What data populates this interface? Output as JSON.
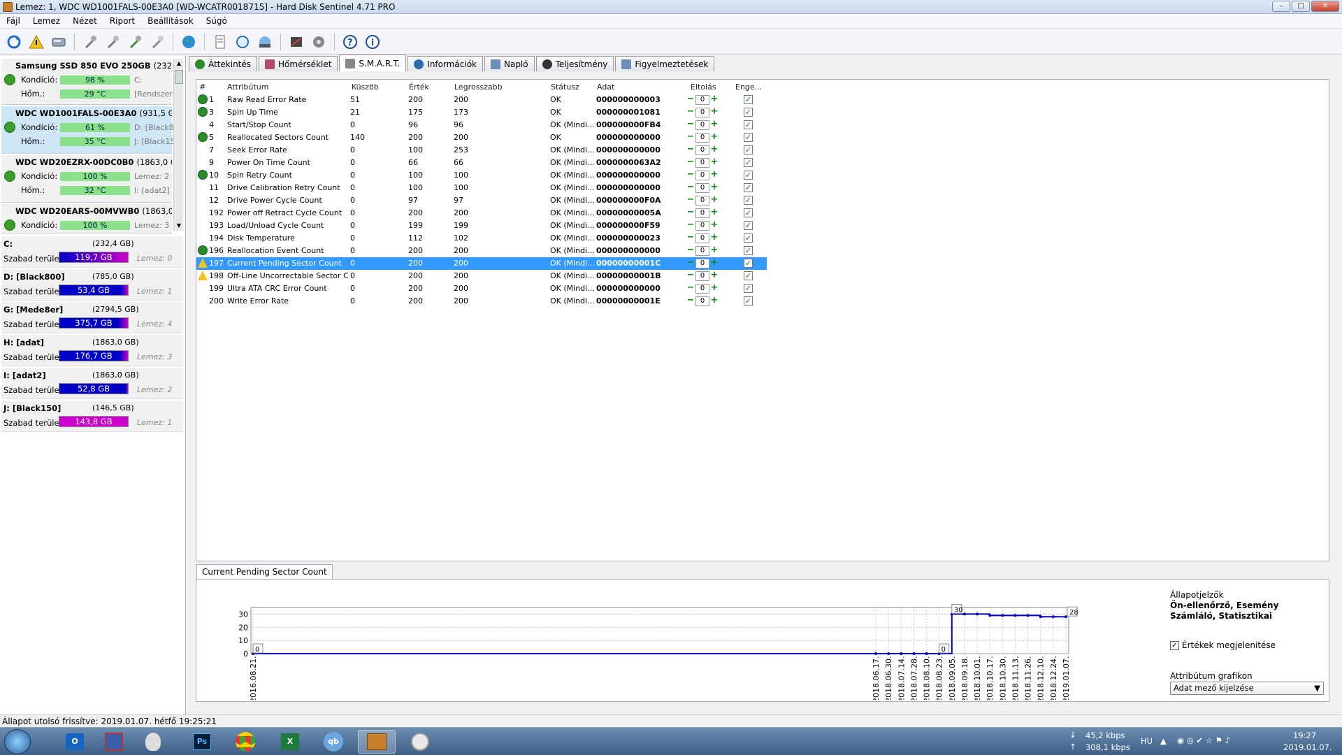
{
  "window": {
    "title": "Lemez: 1, WDC WD1001FALS-00E3A0 [WD-WCATR0018715] - Hard Disk Sentinel 4.71 PRO",
    "minimize": "–",
    "maximize": "□",
    "close": "✕"
  },
  "menu": [
    "Fájl",
    "Lemez",
    "Nézet",
    "Riport",
    "Beállítások",
    "Súgó"
  ],
  "disks": [
    {
      "name": "Samsung SSD 850 EVO 250GB",
      "size": "(232,9 GB)",
      "kondicio_label": "Kondíció:",
      "kondicio": "98 %",
      "kondicio_extra": "C:",
      "hom_label": "Hőm.:",
      "hom": "29 °C",
      "hom_extra": "[Rendszer"
    },
    {
      "name": "WDC WD1001FALS-00E3A0",
      "size": "(931,5 GB)",
      "kondicio_label": "Kondíció:",
      "kondicio": "61 %",
      "kondicio_extra": "D: [Black8",
      "hom_label": "Hőm.:",
      "hom": "35 °C",
      "hom_extra": "J: [Black15"
    },
    {
      "name": "WDC WD20EZRX-00DC0B0",
      "size": "(1863,0 GB)",
      "kondicio_label": "Kondíció:",
      "kondicio": "100 %",
      "kondicio_extra": "Lemez: 2",
      "hom_label": "Hőm.:",
      "hom": "32 °C",
      "hom_extra": "I: [adat2]"
    },
    {
      "name": "WDC WD20EARS-00MVWB0",
      "size": "(1863,0 GB)",
      "kondicio_label": "Kondíció:",
      "kondicio": "100 %",
      "kondicio_extra": "Lemez: 3"
    }
  ],
  "volumes": [
    {
      "name": "C:",
      "size": "(232,4 GB)",
      "free_label": "Szabad terület",
      "free": "119,7 GB",
      "disk": "Lemez: 0",
      "color": "#cc00cc"
    },
    {
      "name": "D: [Black800]",
      "size": "(785,0 GB)",
      "free_label": "Szabad terület",
      "free": "53,4 GB",
      "disk": "Lemez: 1",
      "color": "#0000cc"
    },
    {
      "name": "G: [Mede8er]",
      "size": "(2794,5 GB)",
      "free_label": "Szabad terület",
      "free": "375,7 GB",
      "disk": "Lemez: 4",
      "color": "#0000cc"
    },
    {
      "name": "H: [adat]",
      "size": "(1863,0 GB)",
      "free_label": "Szabad terület",
      "free": "176,7 GB",
      "disk": "Lemez: 3",
      "color": "#0000cc"
    },
    {
      "name": "I: [adat2]",
      "size": "(1863,0 GB)",
      "free_label": "Szabad terület",
      "free": "52,8 GB",
      "disk": "Lemez: 2",
      "color": "#0000cc"
    },
    {
      "name": "J: [Black150]",
      "size": "(146,5 GB)",
      "free_label": "Szabad terület",
      "free": "143,8 GB",
      "disk": "Lemez: 1",
      "color": "#cc00cc"
    }
  ],
  "tabs": [
    "Áttekintés",
    "Hőmérséklet",
    "S.M.A.R.T.",
    "Információk",
    "Napló",
    "Teljesítmény",
    "Figyelmeztetések"
  ],
  "smart_headers": {
    "num": "#",
    "attr": "Attribútum",
    "threshold": "Küszöb",
    "value": "Érték",
    "worst": "Legrosszabb",
    "status": "Státusz",
    "data": "Adat",
    "offset": "Eltolás",
    "enable": "Enge..."
  },
  "smart_rows": [
    {
      "id": "1",
      "name": "Raw Read Error Rate",
      "thr": "51",
      "val": "200",
      "worst": "200",
      "status": "OK",
      "data": "000000000003",
      "icon": "ok"
    },
    {
      "id": "3",
      "name": "Spin Up Time",
      "thr": "21",
      "val": "175",
      "worst": "173",
      "status": "OK",
      "data": "000000001081",
      "icon": "ok"
    },
    {
      "id": "4",
      "name": "Start/Stop Count",
      "thr": "0",
      "val": "96",
      "worst": "96",
      "status": "OK (Mindi...",
      "data": "000000000FB4",
      "icon": ""
    },
    {
      "id": "5",
      "name": "Reallocated Sectors Count",
      "thr": "140",
      "val": "200",
      "worst": "200",
      "status": "OK",
      "data": "000000000000",
      "icon": "ok"
    },
    {
      "id": "7",
      "name": "Seek Error Rate",
      "thr": "0",
      "val": "100",
      "worst": "253",
      "status": "OK (Mindi...",
      "data": "000000000000",
      "icon": ""
    },
    {
      "id": "9",
      "name": "Power On Time Count",
      "thr": "0",
      "val": "66",
      "worst": "66",
      "status": "OK (Mindi...",
      "data": "0000000063A2",
      "icon": ""
    },
    {
      "id": "10",
      "name": "Spin Retry Count",
      "thr": "0",
      "val": "100",
      "worst": "100",
      "status": "OK (Mindi...",
      "data": "000000000000",
      "icon": "ok"
    },
    {
      "id": "11",
      "name": "Drive Calibration Retry Count",
      "thr": "0",
      "val": "100",
      "worst": "100",
      "status": "OK (Mindi...",
      "data": "000000000000",
      "icon": ""
    },
    {
      "id": "12",
      "name": "Drive Power Cycle Count",
      "thr": "0",
      "val": "97",
      "worst": "97",
      "status": "OK (Mindi...",
      "data": "000000000F0A",
      "icon": ""
    },
    {
      "id": "192",
      "name": "Power off Retract Cycle Count",
      "thr": "0",
      "val": "200",
      "worst": "200",
      "status": "OK (Mindi...",
      "data": "00000000005A",
      "icon": ""
    },
    {
      "id": "193",
      "name": "Load/Unload Cycle Count",
      "thr": "0",
      "val": "199",
      "worst": "199",
      "status": "OK (Mindi...",
      "data": "000000000F59",
      "icon": ""
    },
    {
      "id": "194",
      "name": "Disk Temperature",
      "thr": "0",
      "val": "112",
      "worst": "102",
      "status": "OK (Mindi...",
      "data": "000000000023",
      "icon": ""
    },
    {
      "id": "196",
      "name": "Reallocation Event Count",
      "thr": "0",
      "val": "200",
      "worst": "200",
      "status": "OK (Mindi...",
      "data": "000000000000",
      "icon": "ok"
    },
    {
      "id": "197",
      "name": "Current Pending Sector Count",
      "thr": "0",
      "val": "200",
      "worst": "200",
      "status": "OK (Mindi...",
      "data": "00000000001C",
      "icon": "warn",
      "selected": true
    },
    {
      "id": "198",
      "name": "Off-Line Uncorrectable Sector C...",
      "thr": "0",
      "val": "200",
      "worst": "200",
      "status": "OK (Mindi...",
      "data": "00000000001B",
      "icon": "warn"
    },
    {
      "id": "199",
      "name": "Ultra ATA CRC Error Count",
      "thr": "0",
      "val": "200",
      "worst": "200",
      "status": "OK (Mindi...",
      "data": "000000000000",
      "icon": ""
    },
    {
      "id": "200",
      "name": "Write Error Rate",
      "thr": "0",
      "val": "200",
      "worst": "200",
      "status": "OK (Mindi...",
      "data": "00000000001E",
      "icon": ""
    }
  ],
  "offset_value": "0",
  "graph": {
    "tab": "Current Pending Sector Count"
  },
  "chart_data": {
    "type": "line",
    "title": "",
    "x": [
      "2016.08.21.",
      "2018.06.17.",
      "2018.06.30.",
      "2018.07.14.",
      "2018.07.28.",
      "2018.08.10.",
      "2018.08.23.",
      "2018.09.05.",
      "2018.09.18.",
      "2018.10.01.",
      "2018.10.17.",
      "2018.10.30.",
      "2018.11.13.",
      "2018.11.26.",
      "2018.12.10.",
      "2018.12.24.",
      "2019.01.07."
    ],
    "y": [
      0,
      0,
      0,
      0,
      0,
      0,
      0,
      30,
      30,
      30,
      29,
      29,
      29,
      29,
      28,
      28,
      28
    ],
    "yticks": [
      "0",
      "10",
      "20",
      "30"
    ],
    "ylim": [
      0,
      35
    ],
    "annotations": [
      "0",
      "0",
      "30",
      "28"
    ],
    "color": "#0000c8"
  },
  "graph_options": {
    "heading": "Állapotjelzők",
    "kinds": "Ön-ellenőrző, Esemény Számláló, Statisztikai",
    "show_values": "Értékek megjelenítése",
    "attr_graph": "Attribútum grafikon",
    "select": "Adat mező kijelzése"
  },
  "status": "Állapot utolsó frissítve: 2019.01.07. hétfő 19:25:21",
  "tray": {
    "down": "45,2 kbps",
    "up": "308,1 kbps",
    "lang": "HU",
    "time": "19:27",
    "date": "2019.01.07."
  }
}
